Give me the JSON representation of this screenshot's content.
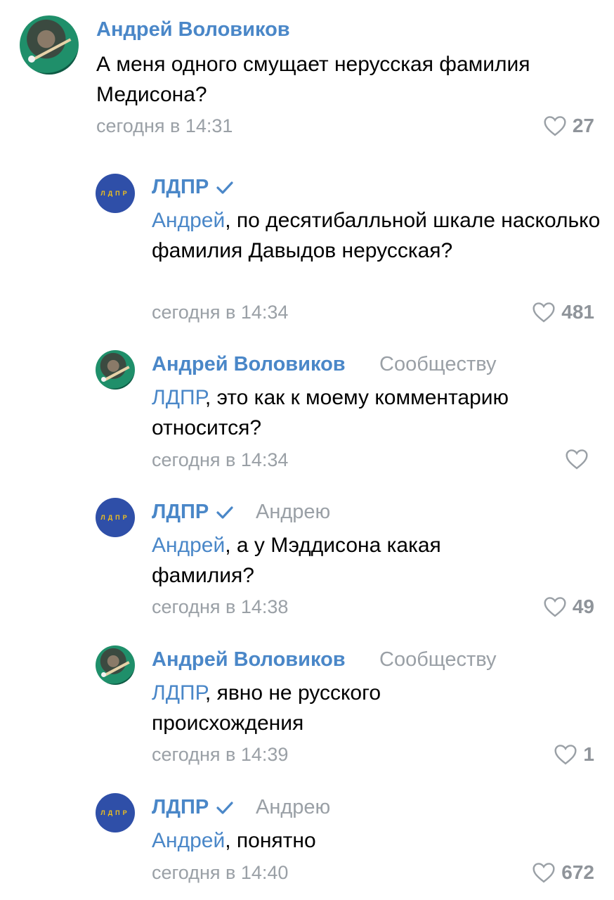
{
  "comments": [
    {
      "author": "Андрей Воловиков",
      "reply_to": "",
      "mention": "",
      "text": "А меня одного смущает нерусская фамилия Медисона?",
      "time": "сегодня в 14:31",
      "likes": "27",
      "avatar": "billiard-player-photo",
      "verified": false
    },
    {
      "author": "ЛДПР",
      "reply_to": "",
      "mention": "Андрей",
      "text": ", по десятибалльной шкале насколько фамилия Давыдов нерусская?",
      "time": "сегодня в 14:34",
      "likes": "481",
      "avatar": "ldpr-logo",
      "logo_text": "ЛДПР",
      "verified": true
    },
    {
      "author": "Андрей Воловиков",
      "reply_to": "Сообществу",
      "mention": "ЛДПР",
      "text": ", это как к моему комментарию относится?",
      "time": "сегодня в 14:34",
      "likes": "",
      "avatar": "billiard-player-photo",
      "verified": false
    },
    {
      "author": "ЛДПР",
      "reply_to": "Андрею",
      "mention": "Андрей",
      "text": ", а у Мэддисона какая фамилия?",
      "time": "сегодня в 14:38",
      "likes": "49",
      "avatar": "ldpr-logo",
      "logo_text": "ЛДПР",
      "verified": true
    },
    {
      "author": "Андрей Воловиков",
      "reply_to": "Сообществу",
      "mention": "ЛДПР",
      "text": ", явно не русского происхождения",
      "time": "сегодня в 14:39",
      "likes": "1",
      "avatar": "billiard-player-photo",
      "verified": false
    },
    {
      "author": "ЛДПР",
      "reply_to": "Андрею",
      "mention": "Андрей",
      "text": ", понятно",
      "time": "сегодня в 14:40",
      "likes": "672",
      "avatar": "ldpr-logo",
      "logo_text": "ЛДПР",
      "verified": true
    }
  ],
  "colors": {
    "link": "#4a87c8",
    "meta": "#9aa0a6",
    "like": "#8f949a",
    "logo_bg": "#2f4fa8",
    "logo_text": "#f2c21b"
  }
}
